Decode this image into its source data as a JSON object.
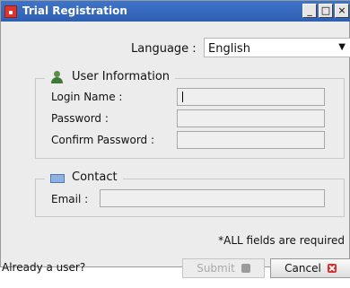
{
  "window": {
    "title": "Trial Registration",
    "controls": {
      "minimize": "_",
      "maximize": "□",
      "close": "×"
    }
  },
  "language": {
    "label": "Language :",
    "selected": "English"
  },
  "user_info": {
    "legend": "User Information",
    "login_name_label": "Login Name :",
    "password_label": "Password :",
    "confirm_password_label": "Confirm Password :"
  },
  "contact": {
    "legend": "Contact",
    "email_label": "Email :"
  },
  "required_note": "*ALL fields are required",
  "footer": {
    "already_user": "Already a user?",
    "submit_label": "Submit",
    "cancel_label": "Cancel"
  },
  "colors": {
    "titlebar": "#2f5fb3",
    "cancel_icon": "#d62d2d"
  },
  "icons": [
    "app-icon",
    "user-icon",
    "mail-icon",
    "submit-icon",
    "cancel-icon"
  ]
}
